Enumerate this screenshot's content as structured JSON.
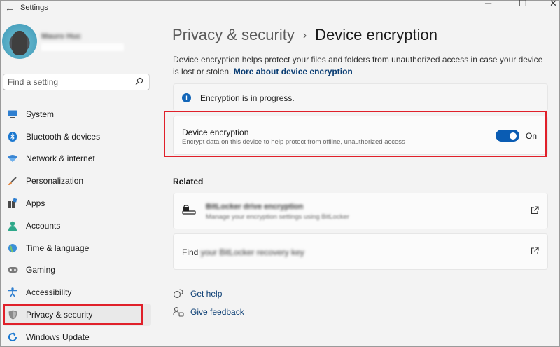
{
  "app": {
    "title": "Settings"
  },
  "window": {
    "minimize": "─",
    "maximize": "☐",
    "close": "✕"
  },
  "user": {
    "name": "Mauro Huc"
  },
  "search": {
    "placeholder": "Find a setting"
  },
  "sidebar": {
    "items": [
      {
        "label": "System",
        "icon": "system-icon"
      },
      {
        "label": "Bluetooth & devices",
        "icon": "bluetooth-icon"
      },
      {
        "label": "Network & internet",
        "icon": "wifi-icon"
      },
      {
        "label": "Personalization",
        "icon": "brush-icon"
      },
      {
        "label": "Apps",
        "icon": "apps-icon"
      },
      {
        "label": "Accounts",
        "icon": "person-icon"
      },
      {
        "label": "Time & language",
        "icon": "globe-icon"
      },
      {
        "label": "Gaming",
        "icon": "gamepad-icon"
      },
      {
        "label": "Accessibility",
        "icon": "accessibility-icon"
      },
      {
        "label": "Privacy & security",
        "icon": "shield-icon",
        "selected": true
      },
      {
        "label": "Windows Update",
        "icon": "update-icon"
      }
    ]
  },
  "header": {
    "parent": "Privacy & security",
    "separator": "›",
    "current": "Device encryption"
  },
  "description": {
    "text": "Device encryption helps protect your files and folders from unauthorized access in case your device is lost or stolen.",
    "link": "More about device encryption"
  },
  "info": {
    "text": "Encryption is in progress."
  },
  "encryption": {
    "title": "Device encryption",
    "subtitle": "Encrypt data on this device to help protect from offline, unauthorized access",
    "toggle_on": true,
    "toggle_label": "On"
  },
  "related": {
    "heading": "Related",
    "items": [
      {
        "title": "BitLocker drive encryption",
        "subtitle": "Manage your encryption settings using BitLocker"
      },
      {
        "title_prefix": "Find",
        "title_rest": "your BitLocker recovery key"
      }
    ]
  },
  "help": {
    "get_help": "Get help",
    "give_feedback": "Give feedback"
  },
  "colors": {
    "accent": "#0a5cb3",
    "highlight": "#e0202a",
    "link": "#0a3d73"
  }
}
